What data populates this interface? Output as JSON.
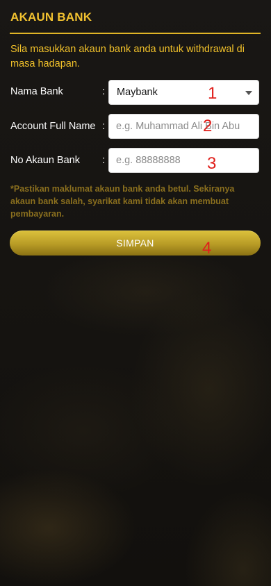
{
  "header": {
    "title": "AKAUN BANK"
  },
  "intro_text": "Sila masukkan akaun bank anda untuk withdrawal di masa hadapan.",
  "form": {
    "bank_name": {
      "label": "Nama Bank",
      "colon": ":",
      "selected": "Maybank"
    },
    "full_name": {
      "label": "Account Full Name",
      "colon": ":",
      "placeholder": "e.g. Muhammad Ali Bin Abu"
    },
    "account_no": {
      "label": "No Akaun Bank",
      "colon": ":",
      "placeholder": "e.g. 88888888"
    }
  },
  "note": "*Pastikan maklumat akaun bank anda betul. Sekiranya akaun bank salah, syarikat kami tidak akan membuat pembayaran.",
  "save_button": {
    "label": "SIMPAN"
  },
  "annotations": [
    "1",
    "2",
    "3",
    "4"
  ],
  "colors": {
    "accent": "#f2c230",
    "note": "#8a6f1e",
    "button": "#b89b26",
    "annotation": "#e0201c"
  },
  "icons": {
    "dropdown": "chevron-down-icon"
  }
}
